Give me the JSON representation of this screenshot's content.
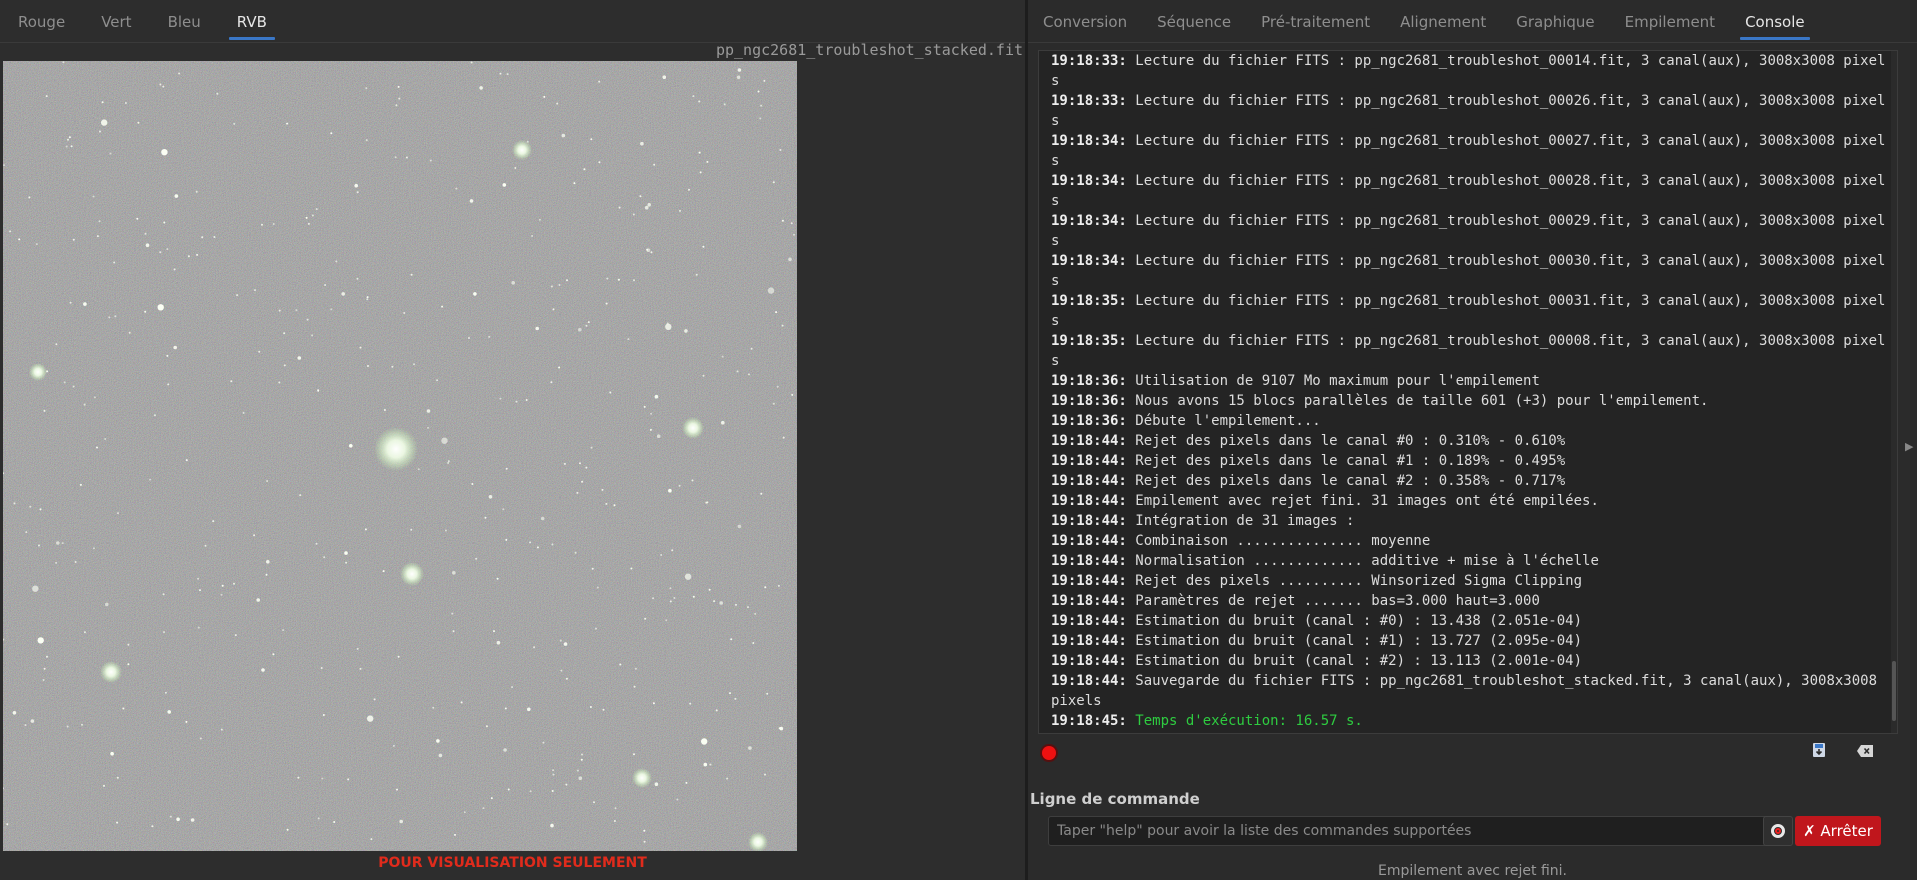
{
  "left_tabs": [
    {
      "label": "Rouge",
      "active": false
    },
    {
      "label": "Vert",
      "active": false
    },
    {
      "label": "Bleu",
      "active": false
    },
    {
      "label": "RVB",
      "active": true
    }
  ],
  "image_filename": "pp_ngc2681_troubleshot_stacked.fit",
  "preview_label": "POUR VISUALISATION SEULEMENT",
  "right_tabs": [
    {
      "label": "Conversion",
      "active": false
    },
    {
      "label": "Séquence",
      "active": false
    },
    {
      "label": "Pré-traitement",
      "active": false
    },
    {
      "label": "Alignement",
      "active": false
    },
    {
      "label": "Graphique",
      "active": false
    },
    {
      "label": "Empilement",
      "active": false
    },
    {
      "label": "Console",
      "active": true
    }
  ],
  "console": {
    "lines": [
      {
        "time": "19:18:33:",
        "text": " Lecture du fichier FITS : pp_ngc2681_troubleshot_00014.fit, 3 canal(aux), 3008x3008 pixels"
      },
      {
        "time": "19:18:33:",
        "text": " Lecture du fichier FITS : pp_ngc2681_troubleshot_00026.fit, 3 canal(aux), 3008x3008 pixels"
      },
      {
        "time": "19:18:34:",
        "text": " Lecture du fichier FITS : pp_ngc2681_troubleshot_00027.fit, 3 canal(aux), 3008x3008 pixels"
      },
      {
        "time": "19:18:34:",
        "text": " Lecture du fichier FITS : pp_ngc2681_troubleshot_00028.fit, 3 canal(aux), 3008x3008 pixels"
      },
      {
        "time": "19:18:34:",
        "text": " Lecture du fichier FITS : pp_ngc2681_troubleshot_00029.fit, 3 canal(aux), 3008x3008 pixels"
      },
      {
        "time": "19:18:34:",
        "text": " Lecture du fichier FITS : pp_ngc2681_troubleshot_00030.fit, 3 canal(aux), 3008x3008 pixels"
      },
      {
        "time": "19:18:35:",
        "text": " Lecture du fichier FITS : pp_ngc2681_troubleshot_00031.fit, 3 canal(aux), 3008x3008 pixels"
      },
      {
        "time": "19:18:35:",
        "text": " Lecture du fichier FITS : pp_ngc2681_troubleshot_00008.fit, 3 canal(aux), 3008x3008 pixels"
      },
      {
        "time": "19:18:36:",
        "text": " Utilisation de 9107 Mo maximum pour l'empilement"
      },
      {
        "time": "19:18:36:",
        "text": " Nous avons 15 blocs parallèles de taille 601 (+3) pour l'empilement."
      },
      {
        "time": "19:18:36:",
        "text": " Débute l'empilement..."
      },
      {
        "time": "19:18:44:",
        "text": " Rejet des pixels dans le canal #0 : 0.310% - 0.610%"
      },
      {
        "time": "19:18:44:",
        "text": " Rejet des pixels dans le canal #1 : 0.189% - 0.495%"
      },
      {
        "time": "19:18:44:",
        "text": " Rejet des pixels dans le canal #2 : 0.358% - 0.717%"
      },
      {
        "time": "19:18:44:",
        "text": " Empilement avec rejet fini. 31 images ont été empilées."
      },
      {
        "time": "19:18:44:",
        "text": " Intégration de 31 images :"
      },
      {
        "time": "19:18:44:",
        "text": " Combinaison ............... moyenne"
      },
      {
        "time": "19:18:44:",
        "text": " Normalisation ............. additive + mise à l'échelle"
      },
      {
        "time": "19:18:44:",
        "text": " Rejet des pixels .......... Winsorized Sigma Clipping"
      },
      {
        "time": "19:18:44:",
        "text": " Paramètres de rejet ....... bas=3.000 haut=3.000"
      },
      {
        "time": "19:18:44:",
        "text": " Estimation du bruit (canal : #0) : 13.438 (2.051e-04)"
      },
      {
        "time": "19:18:44:",
        "text": " Estimation du bruit (canal : #1) : 13.727 (2.095e-04)"
      },
      {
        "time": "19:18:44:",
        "text": " Estimation du bruit (canal : #2) : 13.113 (2.001e-04)"
      },
      {
        "time": "19:18:44:",
        "text": " Sauvegarde du fichier FITS : pp_ngc2681_troubleshot_stacked.fit, 3 canal(aux), 3008x3008 pixels"
      },
      {
        "time": "19:18:45:",
        "text": " Temps d'exécution: 16.57 s.",
        "color": "green"
      }
    ]
  },
  "command": {
    "label": "Ligne de commande",
    "placeholder": "Taper \"help\" pour avoir la liste des commandes supportées",
    "value": "",
    "stop_label": "Arrêter"
  },
  "status_text": "Empilement avec rejet fini.",
  "icons": {
    "record": "record-icon",
    "save_log": "save-log-icon",
    "clear_log": "clear-log-icon",
    "help": "help-lifebuoy-icon",
    "stop": "stop-x-icon"
  },
  "colors": {
    "accent": "#3a77c7",
    "stop_button": "#c0161c",
    "preview_label": "#e02b1c",
    "success": "#2ecc40"
  }
}
